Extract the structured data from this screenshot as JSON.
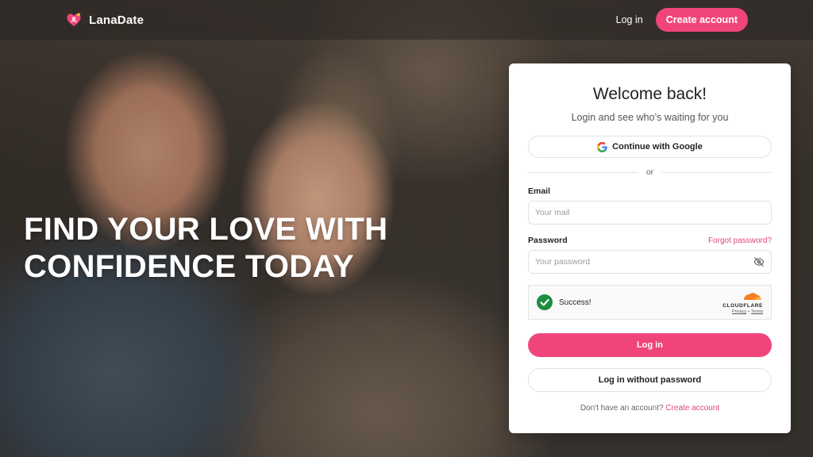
{
  "brand": {
    "name": "LanaDate",
    "icon": "heart-logo-icon",
    "accent_color": "#f0457b"
  },
  "header": {
    "login_label": "Log in",
    "create_account_label": "Create account"
  },
  "hero": {
    "headline_line1": "FIND YOUR LOVE WITH",
    "headline_line2": "CONFIDENCE TODAY"
  },
  "login_card": {
    "title": "Welcome back!",
    "subtitle": "Login and see who’s waiting for you",
    "google_button_label": "Continue with Google",
    "divider_text": "or",
    "email_label": "Email",
    "email_placeholder": "Your mail",
    "password_label": "Password",
    "forgot_password_label": "Forgot password?",
    "password_placeholder": "Your password",
    "captcha": {
      "status_text": "Success!",
      "provider": "CLOUDFLARE",
      "privacy_label": "Privacy",
      "separator": "•",
      "terms_label": "Terms"
    },
    "login_button_label": "Log in",
    "passwordless_button_label": "Log in without password",
    "signup_prompt": "Don't have an account?",
    "signup_link_label": "Create account"
  }
}
